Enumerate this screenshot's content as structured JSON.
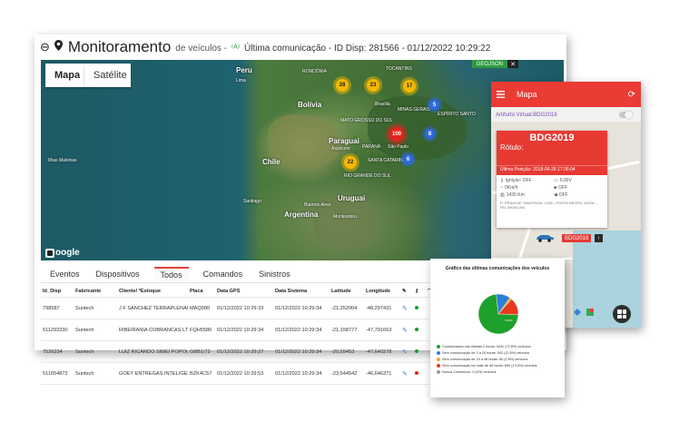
{
  "main": {
    "title": "Monitoramento",
    "subtitle": "de veículos",
    "separator": "-",
    "last_comm": "Última comunicação - ID Disp: 281566 - 01/12/2022 10:29:22",
    "map_tabs": [
      "Mapa",
      "Satélite"
    ],
    "map_badge": "GEOJSON",
    "map_badge_close": "✕",
    "map_labels": {
      "peru": "Peru",
      "lima": "Lima",
      "bolivia": "Bolívia",
      "chile": "Chile",
      "paraguai": "Paraguai",
      "asuncion": "Asunción",
      "uruguai": "Uruguai",
      "argentina": "Argentina",
      "santiago": "Santiago",
      "buenos_aires": "Buenos Aires",
      "montevideu": "Montevidéu",
      "brasilia": "Brasília",
      "sao_paulo": "São Paulo",
      "ilhas": "Ilhas Malvinas",
      "rondonia": "RONDÔNIA",
      "tocantins": "TOCANTINS",
      "mato_grosso": "MATO GROSSO DO SUL",
      "minas": "MINAS GERAIS",
      "espirito": "ESPÍRITO SANTO",
      "parana": "PARANÁ",
      "santa_catarina": "SANTA CATARINA",
      "rio_grande": "RIO GRANDE DO SUL"
    },
    "clusters": [
      "28",
      "23",
      "17",
      "5",
      "100",
      "8",
      "22",
      "6"
    ],
    "google": "oogle",
    "tabs": [
      "Eventos",
      "Dispositivos",
      "Todos",
      "Comandos",
      "Sinistros"
    ],
    "columns": [
      "Id_Disp",
      "Fabricante",
      "Cliente/ *Estoque",
      "Placa",
      "Data GPS",
      "Data Sistema",
      "Latitude",
      "Longitude",
      "",
      "",
      "",
      "E1",
      "E2",
      "E3"
    ],
    "rows": [
      {
        "id": "798587",
        "fab": "Suntech",
        "cli": "J F SANCHEZ TERRAPLENAGEI",
        "placa": "MAQ000",
        "gps": "01/12/2022 10:29:33",
        "sis": "01/12/2022 10:29:34",
        "lat": "-21,252004",
        "lon": "-48,297431",
        "dot": "#1a9a3b"
      },
      {
        "id": "511293330",
        "fab": "Suntech",
        "cli": "RIBEIRANIA COBRANCAS LTD.",
        "placa": "FQH5580",
        "gps": "01/12/2022 10:29:34",
        "sis": "01/12/2022 10:29:34",
        "lat": "-21,158777",
        "lon": "-47,791663",
        "dot": "#1a9a3b"
      },
      {
        "id": "7526234",
        "fab": "Suntech",
        "cli": "LUIZ RICARDO SIMEI POPOUR",
        "placa": "GBB1/72",
        "gps": "01/12/2022 10:29:27",
        "sis": "01/12/2022 10:29:34",
        "lat": "-20,59453",
        "lon": "-47,640278",
        "dot": "#1a9a3b"
      },
      {
        "id": "511654872",
        "fab": "Suntech",
        "cli": "GOEY ENTREGAS INTELIGENT",
        "placa": "BZK4C57",
        "gps": "01/12/2022 10:29:53",
        "sis": "01/12/2022 10:29:34",
        "lat": "-23,544542",
        "lon": "-46,646371",
        "dot": "#e2231a"
      }
    ]
  },
  "mobile": {
    "title": "Mapa",
    "artifact": "Artifurto Virtual:BDG2019",
    "vehicle_name": "BDG2019",
    "rotulo": "Rótulo:",
    "last_position": "Última Posição: 2018-06-28 17:36:04",
    "ignicao": "Ignição: OFF",
    "voltage": "0,00V",
    "speed": "0Km/h",
    "lock": "OFF",
    "odometer": "1435 Km",
    "sound": "OFF",
    "address": "R. PRAIA DE TABATINGA, 2185 - PONTA NEGRA, NATAL - RN, 59090-090",
    "plate": "BDG2019",
    "arrow": "↑"
  },
  "chart_data": {
    "type": "pie",
    "title": "Gráfico das últimas comunicações dos veículos",
    "center_label": "72,8%",
    "series": [
      {
        "name": "Comunicaram nas últimas 2 horas: 3441 (72.8%) veículos",
        "value": 72.8,
        "color": "#1ea02c"
      },
      {
        "name": "Sem comunicação de 2 a 24 horas: 542 (11.5%) veículos",
        "value": 11.5,
        "color": "#2e7fd6"
      },
      {
        "name": "Sem comunicação de 24 a 48 horas: 85 (1.8%) veículos",
        "value": 1.8,
        "color": "#f0a81c"
      },
      {
        "name": "Sem comunicação há mais de 48 horas: 659 (13.9%) veículos",
        "value": 13.9,
        "color": "#e63a1c"
      },
      {
        "name": "Nunca Comunicou: 0 (0%) veículos",
        "value": 0,
        "color": "#9a9a9a"
      }
    ]
  }
}
